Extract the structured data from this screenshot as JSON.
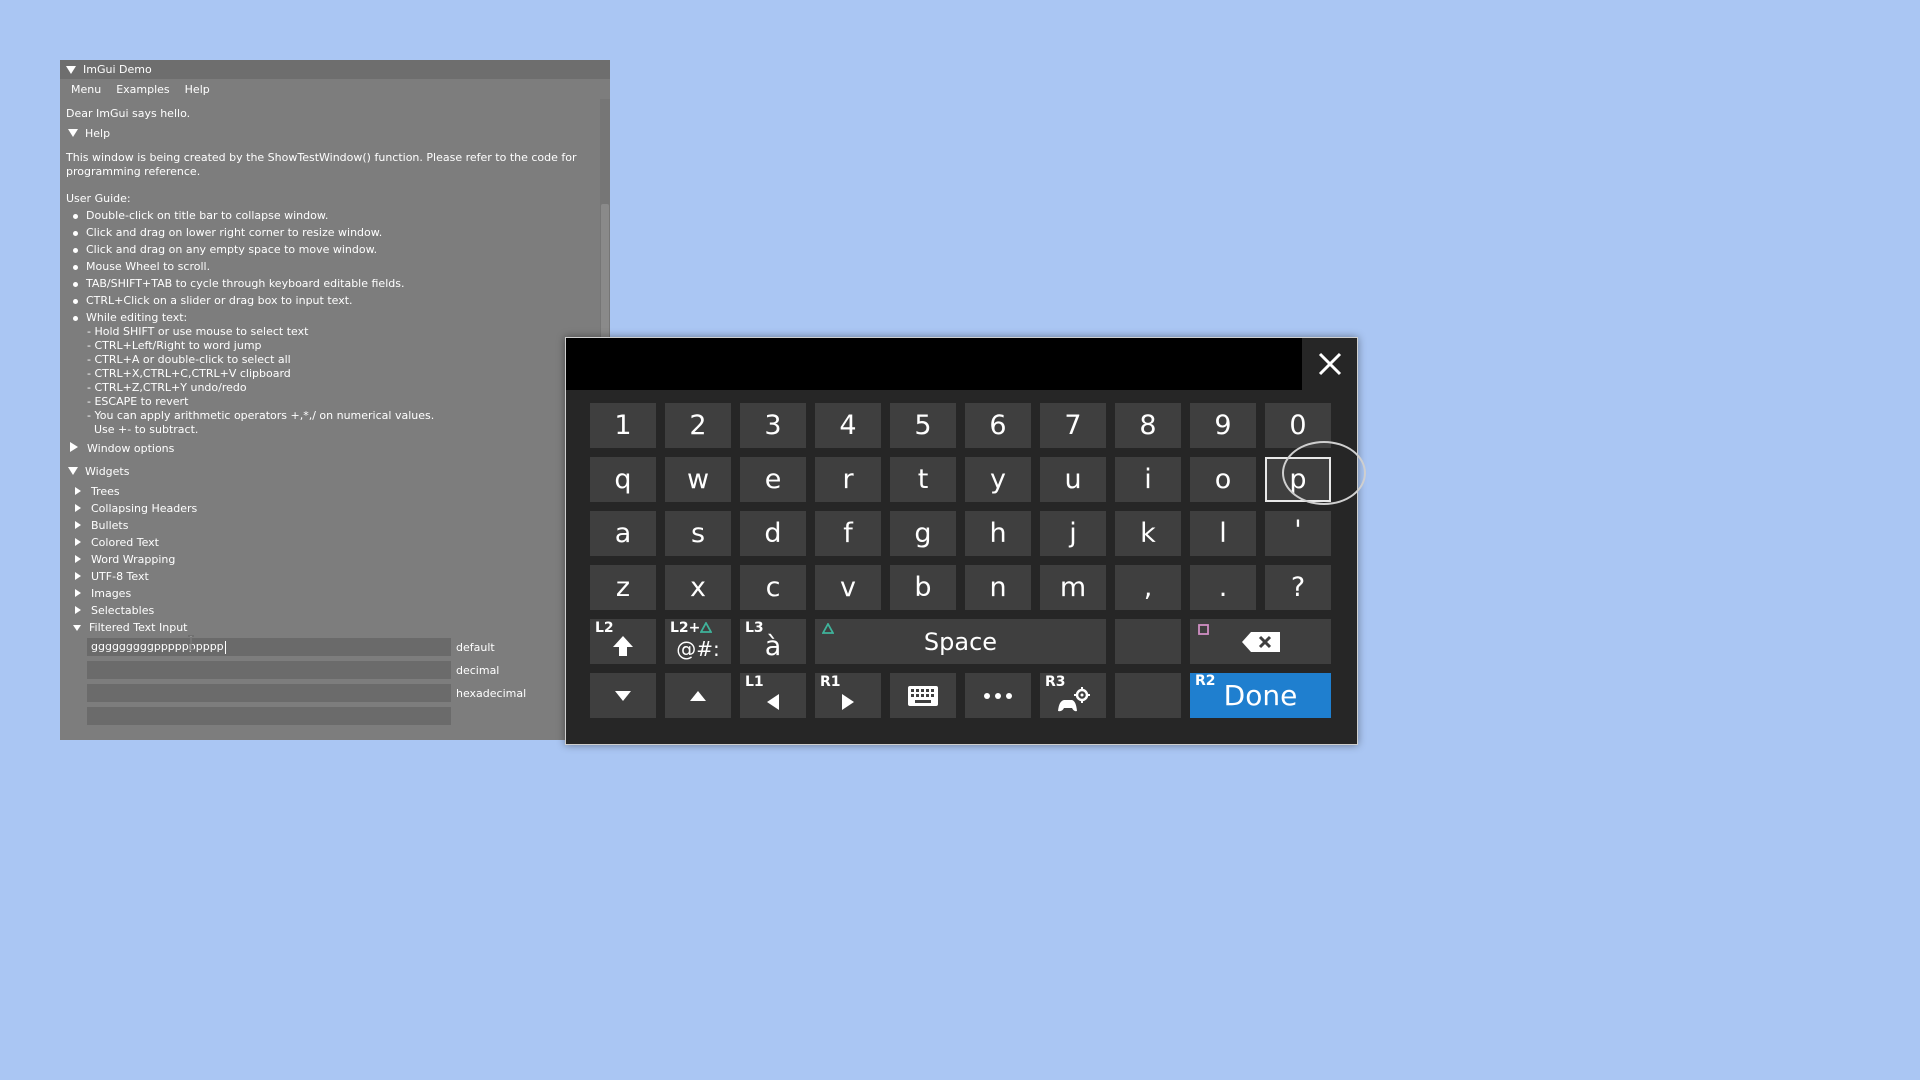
{
  "imgui": {
    "title": "ImGui Demo",
    "menu": [
      "Menu",
      "Examples",
      "Help"
    ],
    "greeting": "Dear ImGui says hello.",
    "help_header": "Help",
    "help_text_1": "This window is being created by the ShowTestWindow() function. Please refer to the code for",
    "help_text_2": "programming reference.",
    "user_guide": "User Guide:",
    "bullets": [
      "Double-click on title bar to collapse window.",
      "Click and drag on lower right corner to resize window.",
      "Click and drag on any empty space to move window.",
      "Mouse Wheel to scroll.",
      "TAB/SHIFT+TAB to cycle through keyboard editable fields.",
      "CTRL+Click on a slider or drag box to input text.",
      "While editing text:"
    ],
    "editing_lines": [
      "- Hold SHIFT or use mouse to select text",
      "- CTRL+Left/Right to word jump",
      "- CTRL+A or double-click to select all",
      "- CTRL+X,CTRL+C,CTRL+V clipboard",
      "- CTRL+Z,CTRL+Y undo/redo",
      "- ESCAPE to revert",
      "- You can apply arithmetic operators +,*,/ on numerical values.",
      "  Use +- to subtract."
    ],
    "window_options": "Window options",
    "widgets": "Widgets",
    "widget_items": [
      "Trees",
      "Collapsing Headers",
      "Bullets",
      "Colored Text",
      "Word Wrapping",
      "UTF-8 Text",
      "Images",
      "Selectables",
      "Filtered Text Input"
    ],
    "inputs": [
      {
        "value": "gggggggggpppppppppp",
        "label": "default"
      },
      {
        "value": "",
        "label": "decimal"
      },
      {
        "value": "",
        "label": "hexadecimal"
      },
      {
        "value": "",
        "label": ""
      }
    ]
  },
  "keyboard": {
    "row1": [
      "1",
      "2",
      "3",
      "4",
      "5",
      "6",
      "7",
      "8",
      "9",
      "0"
    ],
    "row2": [
      "q",
      "w",
      "e",
      "r",
      "t",
      "y",
      "u",
      "i",
      "o",
      "p"
    ],
    "row3": [
      "a",
      "s",
      "d",
      "f",
      "g",
      "h",
      "j",
      "k",
      "l",
      "'"
    ],
    "row4": [
      "z",
      "x",
      "c",
      "v",
      "b",
      "n",
      "m",
      ",",
      ".",
      "?"
    ],
    "shift_tag": "L2",
    "symbols_tag": "L2+",
    "symbols_label": "@#:",
    "accent_tag": "L3",
    "accent_label": "à",
    "space_label": "Space",
    "l1_tag": "L1",
    "r1_tag": "R1",
    "r3_tag": "R3",
    "r2_tag": "R2",
    "done_label": "Done",
    "selected_key": "p",
    "colors": {
      "done": "#1f7fcf",
      "triangle": "#3fb39b",
      "square": "#d08fc4"
    }
  }
}
